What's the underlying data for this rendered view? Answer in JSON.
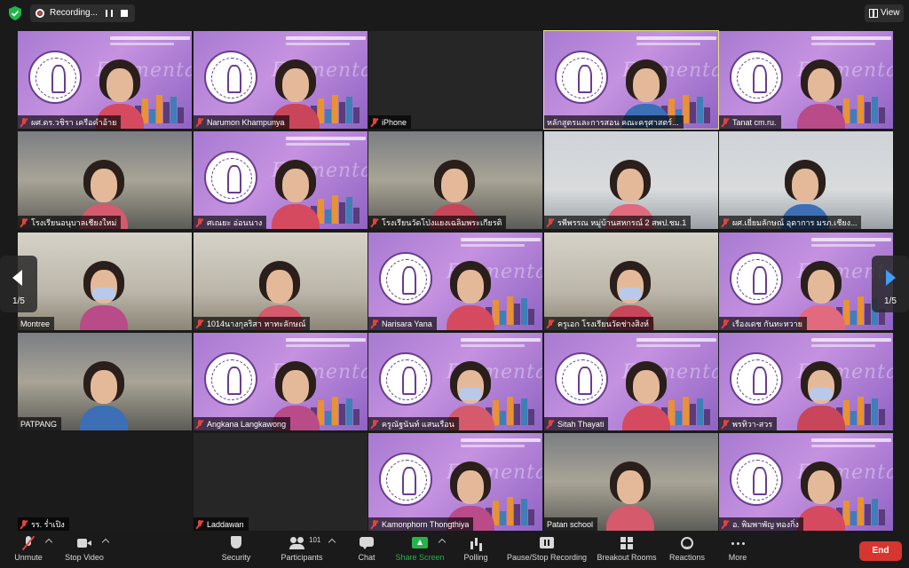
{
  "topbar": {
    "recording_label": "Recording...",
    "view_label": "View"
  },
  "navigation": {
    "page_left": "1/5",
    "page_right": "1/5"
  },
  "participants_tiles": [
    {
      "name": "ผศ.ดร.วชิรา เครือคำอ้าย",
      "muted": true,
      "bg": "slide"
    },
    {
      "name": "Narumon Khampunya",
      "muted": true,
      "bg": "slide"
    },
    {
      "name": "iPhone",
      "muted": true,
      "bg": "blank"
    },
    {
      "name": "หลักสูตรและการสอน คณะครุศาสตร์...",
      "muted": false,
      "bg": "slide",
      "active": true
    },
    {
      "name": "Tanat cm.ru.",
      "muted": true,
      "bg": "slide"
    },
    {
      "name": "โรงเรียนอนุบาลเชียงใหม่",
      "muted": true,
      "bg": "class"
    },
    {
      "name": "ศเณยะ อ่อนนาง",
      "muted": true,
      "bg": "slide"
    },
    {
      "name": "โรงเรียนวัดโป่งแยงเฉลิมพระเกียรติ",
      "muted": true,
      "bg": "class"
    },
    {
      "name": "รพีพรรณ หมู่บ้านสหกรณ์ 2 สพป.ชม.1",
      "muted": true,
      "bg": "office"
    },
    {
      "name": "ผศ.เยี่ยมลักษณ์ อุดาการ มรภ.เชียง...",
      "muted": true,
      "bg": "office"
    },
    {
      "name": "Montree",
      "muted": false,
      "bg": "room"
    },
    {
      "name": "1014นางกุลริสา หาทะลักษณ์",
      "muted": true,
      "bg": "room"
    },
    {
      "name": "Narisara Yana",
      "muted": true,
      "bg": "slide"
    },
    {
      "name": "ครูเอก โรงเรียนวัดช่างสิงห์",
      "muted": true,
      "bg": "room"
    },
    {
      "name": "เรืองเดช กันทะหวาย",
      "muted": true,
      "bg": "slide"
    },
    {
      "name": "PATPANG",
      "muted": false,
      "bg": "class"
    },
    {
      "name": "Angkana Langkawong",
      "muted": true,
      "bg": "slide"
    },
    {
      "name": "ครูณัฐนันท์ แสนเรือน",
      "muted": true,
      "bg": "slide"
    },
    {
      "name": "Sitah Thayati",
      "muted": true,
      "bg": "slide"
    },
    {
      "name": "พรทิวา-สวร",
      "muted": true,
      "bg": "slide"
    },
    {
      "name": "รร. ร่ำเปิง",
      "muted": true,
      "bg": "dark"
    },
    {
      "name": "Laddawan",
      "muted": true,
      "bg": "blank"
    },
    {
      "name": "Kamonphorn Thongthiya",
      "muted": true,
      "bg": "slide"
    },
    {
      "name": "Patan school",
      "muted": false,
      "bg": "class"
    },
    {
      "name": "อ. พิมพาพัญ ทองกิ่ง",
      "muted": true,
      "bg": "slide"
    }
  ],
  "slide": {
    "script_text": "Elementary Education"
  },
  "toolbar": {
    "unmute": "Unmute",
    "stop_video": "Stop Video",
    "security": "Security",
    "participants": "Participants",
    "participants_count": "101",
    "chat": "Chat",
    "share_screen": "Share Screen",
    "polling": "Polling",
    "pause_stop_recording": "Pause/Stop Recording",
    "breakout_rooms": "Breakout Rooms",
    "reactions": "Reactions",
    "more": "More",
    "end": "End"
  },
  "colors": {
    "accent_green": "#23b54b",
    "end_red": "#d6362f",
    "active_speaker": "#e6e37a",
    "slide_purple": "#a77ad1"
  }
}
